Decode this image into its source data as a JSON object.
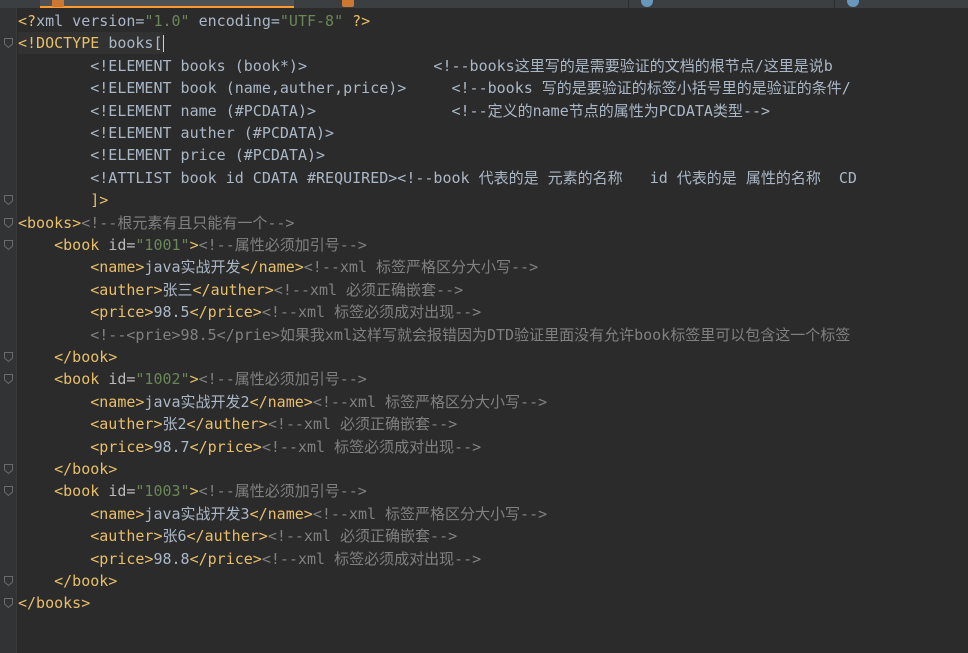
{
  "lines": [
    {
      "parts": [
        {
          "c": "tag",
          "t": "<?"
        },
        {
          "c": "decl",
          "t": "xml version="
        },
        {
          "c": "val",
          "t": "\"1.0\""
        },
        {
          "c": "decl",
          "t": " encoding="
        },
        {
          "c": "val",
          "t": "\"UTF-8\""
        },
        {
          "c": "tag",
          "t": " ?>"
        }
      ]
    },
    {
      "parts": [
        {
          "c": "tag",
          "t": "<!DOCTYPE "
        },
        {
          "c": "txt",
          "t": "books["
        }
      ],
      "caret": true
    },
    {
      "parts": [
        {
          "c": "txt",
          "t": "        <!ELEMENT books (book*)>              "
        },
        {
          "c": "txt",
          "t": "<!--books这里写的是需要验证的文档的根节点/这里是说b"
        }
      ]
    },
    {
      "parts": [
        {
          "c": "txt",
          "t": "        <!ELEMENT book (name,auther,price)>     "
        },
        {
          "c": "txt",
          "t": "<!--books 写的是要验证的标签小括号里的是验证的条件/"
        }
      ]
    },
    {
      "parts": [
        {
          "c": "txt",
          "t": "        <!ELEMENT name (#PCDATA)>               "
        },
        {
          "c": "txt",
          "t": "<!--定义的name节点的属性为PCDATA类型-->"
        }
      ]
    },
    {
      "parts": [
        {
          "c": "txt",
          "t": "        <!ELEMENT auther (#PCDATA)>"
        }
      ]
    },
    {
      "parts": [
        {
          "c": "txt",
          "t": "        <!ELEMENT price (#PCDATA)>"
        }
      ]
    },
    {
      "parts": [
        {
          "c": "txt",
          "t": "        <!ATTLIST book id CDATA #REQUIRED><!--book 代表的是 元素的名称   id 代表的是 属性的名称  CD"
        }
      ]
    },
    {
      "parts": [
        {
          "c": "tag",
          "t": "        ]>"
        }
      ]
    },
    {
      "parts": [
        {
          "c": "tag",
          "t": "<books>"
        },
        {
          "c": "cmt",
          "t": "<!--根元素有且只能有一个-->"
        }
      ]
    },
    {
      "parts": [
        {
          "c": "tag",
          "t": "    <book "
        },
        {
          "c": "attr",
          "t": "id="
        },
        {
          "c": "val",
          "t": "\"1001\""
        },
        {
          "c": "tag",
          "t": ">"
        },
        {
          "c": "cmt",
          "t": "<!--属性必须加引号-->"
        }
      ]
    },
    {
      "parts": [
        {
          "c": "tag",
          "t": "        <name>"
        },
        {
          "c": "txt",
          "t": "java实战开发"
        },
        {
          "c": "tag",
          "t": "</name>"
        },
        {
          "c": "cmt",
          "t": "<!--xml 标签严格区分大小写-->"
        }
      ]
    },
    {
      "parts": [
        {
          "c": "tag",
          "t": "        <auther>"
        },
        {
          "c": "txt",
          "t": "张三"
        },
        {
          "c": "tag",
          "t": "</auther>"
        },
        {
          "c": "cmt",
          "t": "<!--xml 必须正确嵌套-->"
        }
      ]
    },
    {
      "parts": [
        {
          "c": "tag",
          "t": "        <price>"
        },
        {
          "c": "txt",
          "t": "98.5"
        },
        {
          "c": "tag",
          "t": "</price>"
        },
        {
          "c": "cmt",
          "t": "<!--xml 标签必须成对出现-->"
        }
      ]
    },
    {
      "parts": [
        {
          "c": "cmt",
          "t": "        <!--<prie>98.5</prie>如果我xml这样写就会报错因为DTD验证里面没有允许book标签里可以包含这一个标签"
        }
      ]
    },
    {
      "parts": [
        {
          "c": "tag",
          "t": "    </book>"
        }
      ]
    },
    {
      "parts": [
        {
          "c": "tag",
          "t": "    <book "
        },
        {
          "c": "attr",
          "t": "id="
        },
        {
          "c": "val",
          "t": "\"1002\""
        },
        {
          "c": "tag",
          "t": ">"
        },
        {
          "c": "cmt",
          "t": "<!--属性必须加引号-->"
        }
      ]
    },
    {
      "parts": [
        {
          "c": "tag",
          "t": "        <name>"
        },
        {
          "c": "txt",
          "t": "java实战开发2"
        },
        {
          "c": "tag",
          "t": "</name>"
        },
        {
          "c": "cmt",
          "t": "<!--xml 标签严格区分大小写-->"
        }
      ]
    },
    {
      "parts": [
        {
          "c": "tag",
          "t": "        <auther>"
        },
        {
          "c": "txt",
          "t": "张2"
        },
        {
          "c": "tag",
          "t": "</auther>"
        },
        {
          "c": "cmt",
          "t": "<!--xml 必须正确嵌套-->"
        }
      ]
    },
    {
      "parts": [
        {
          "c": "tag",
          "t": "        <price>"
        },
        {
          "c": "txt",
          "t": "98.7"
        },
        {
          "c": "tag",
          "t": "</price>"
        },
        {
          "c": "cmt",
          "t": "<!--xml 标签必须成对出现-->"
        }
      ]
    },
    {
      "parts": [
        {
          "c": "tag",
          "t": "    </book>"
        }
      ]
    },
    {
      "parts": [
        {
          "c": "tag",
          "t": "    <book "
        },
        {
          "c": "attr",
          "t": "id="
        },
        {
          "c": "val",
          "t": "\"1003\""
        },
        {
          "c": "tag",
          "t": ">"
        },
        {
          "c": "cmt",
          "t": "<!--属性必须加引号-->"
        }
      ]
    },
    {
      "parts": [
        {
          "c": "tag",
          "t": "        <name>"
        },
        {
          "c": "txt",
          "t": "java实战开发3"
        },
        {
          "c": "tag",
          "t": "</name>"
        },
        {
          "c": "cmt",
          "t": "<!--xml 标签严格区分大小写-->"
        }
      ]
    },
    {
      "parts": [
        {
          "c": "tag",
          "t": "        <auther>"
        },
        {
          "c": "txt",
          "t": "张6"
        },
        {
          "c": "tag",
          "t": "</auther>"
        },
        {
          "c": "cmt",
          "t": "<!--xml 必须正确嵌套-->"
        }
      ]
    },
    {
      "parts": [
        {
          "c": "tag",
          "t": "        <price>"
        },
        {
          "c": "txt",
          "t": "98.8"
        },
        {
          "c": "tag",
          "t": "</price>"
        },
        {
          "c": "cmt",
          "t": "<!--xml 标签必须成对出现-->"
        }
      ]
    },
    {
      "parts": [
        {
          "c": "tag",
          "t": "    </book>"
        }
      ]
    },
    {
      "parts": [
        {
          "c": "tag",
          "t": "</books>"
        }
      ]
    }
  ],
  "fold_markers": [
    1,
    8,
    9,
    10,
    15,
    16,
    20,
    21,
    25,
    26
  ],
  "colors": {
    "background": "#2b2b2b",
    "tag": "#e8bf6a",
    "string": "#6a8759",
    "comment": "#808080",
    "text": "#a9b7c6",
    "tab_accent": "#ff9a2f"
  }
}
